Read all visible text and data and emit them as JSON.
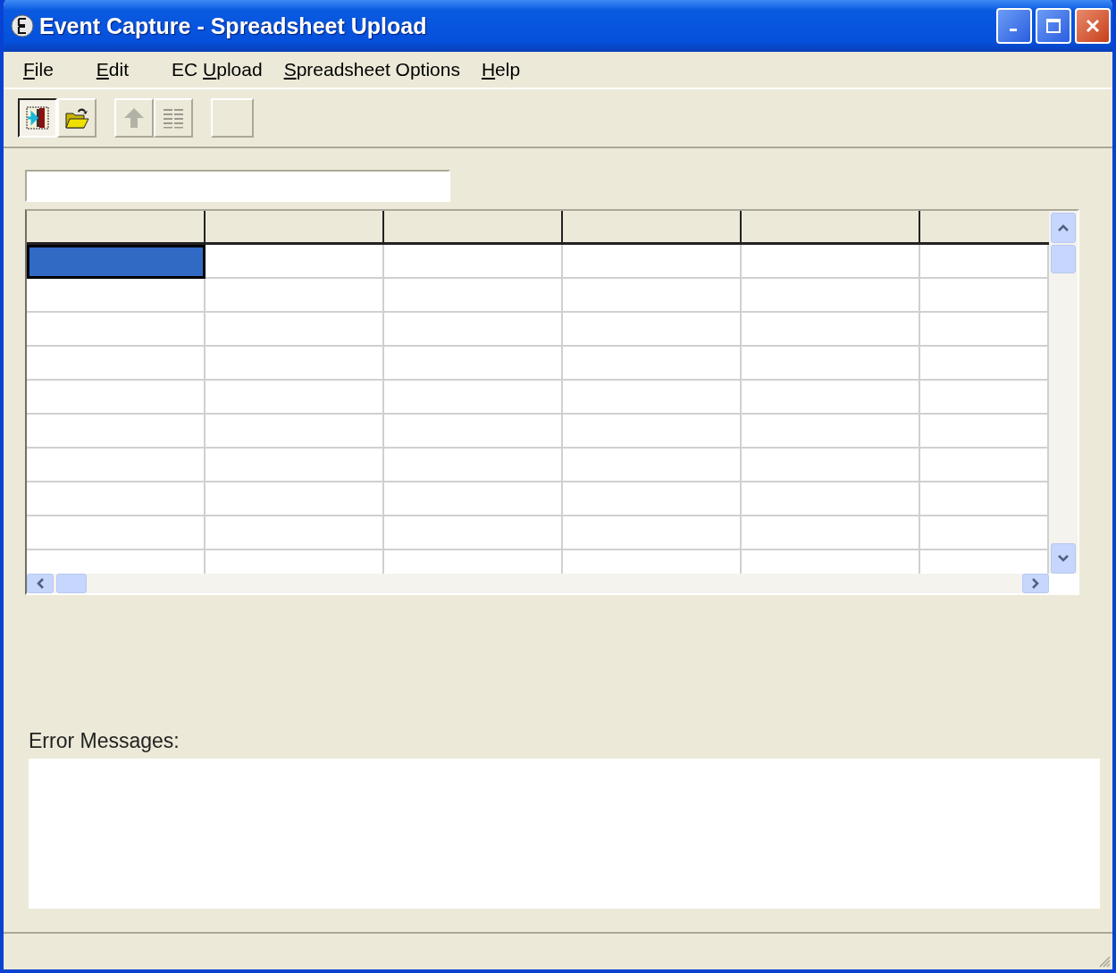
{
  "window": {
    "title": "Event Capture - Spreadsheet Upload"
  },
  "menu": [
    {
      "parts": [
        {
          "text": "F",
          "underline": true
        },
        {
          "text": "ile",
          "underline": false
        }
      ]
    },
    {
      "parts": [
        {
          "text": "E",
          "underline": true
        },
        {
          "text": "dit",
          "underline": false
        }
      ]
    },
    {
      "parts": [
        {
          "text": "EC ",
          "underline": false
        },
        {
          "text": "U",
          "underline": true
        },
        {
          "text": "pload",
          "underline": false
        }
      ]
    },
    {
      "parts": [
        {
          "text": "S",
          "underline": true
        },
        {
          "text": "preadsheet Options",
          "underline": false
        }
      ]
    },
    {
      "parts": [
        {
          "text": "H",
          "underline": true
        },
        {
          "text": "elp",
          "underline": false
        }
      ]
    }
  ],
  "toolbar": [
    {
      "kind": "exit",
      "pressed": true,
      "disabled": false
    },
    {
      "kind": "open",
      "pressed": false,
      "disabled": false
    },
    {
      "kind": "separator"
    },
    {
      "kind": "upload",
      "pressed": false,
      "disabled": true
    },
    {
      "kind": "list",
      "pressed": false,
      "disabled": true
    },
    {
      "kind": "separator"
    },
    {
      "kind": "blank",
      "pressed": false
    }
  ],
  "grid": {
    "rows": [
      {
        "cells": [
          {
            "selected": true
          },
          {
            "selected": false
          },
          {
            "selected": false
          },
          {
            "selected": false
          },
          {
            "selected": false
          },
          {
            "selected": false
          }
        ]
      },
      {
        "cells": [
          {
            "selected": false
          },
          {
            "selected": false
          },
          {
            "selected": false
          },
          {
            "selected": false
          },
          {
            "selected": false
          },
          {
            "selected": false
          }
        ]
      },
      {
        "cells": [
          {
            "selected": false
          },
          {
            "selected": false
          },
          {
            "selected": false
          },
          {
            "selected": false
          },
          {
            "selected": false
          },
          {
            "selected": false
          }
        ]
      },
      {
        "cells": [
          {
            "selected": false
          },
          {
            "selected": false
          },
          {
            "selected": false
          },
          {
            "selected": false
          },
          {
            "selected": false
          },
          {
            "selected": false
          }
        ]
      },
      {
        "cells": [
          {
            "selected": false
          },
          {
            "selected": false
          },
          {
            "selected": false
          },
          {
            "selected": false
          },
          {
            "selected": false
          },
          {
            "selected": false
          }
        ]
      },
      {
        "cells": [
          {
            "selected": false
          },
          {
            "selected": false
          },
          {
            "selected": false
          },
          {
            "selected": false
          },
          {
            "selected": false
          },
          {
            "selected": false
          }
        ]
      },
      {
        "cells": [
          {
            "selected": false
          },
          {
            "selected": false
          },
          {
            "selected": false
          },
          {
            "selected": false
          },
          {
            "selected": false
          },
          {
            "selected": false
          }
        ]
      },
      {
        "cells": [
          {
            "selected": false
          },
          {
            "selected": false
          },
          {
            "selected": false
          },
          {
            "selected": false
          },
          {
            "selected": false
          },
          {
            "selected": false
          }
        ]
      },
      {
        "cells": [
          {
            "selected": false
          },
          {
            "selected": false
          },
          {
            "selected": false
          },
          {
            "selected": false
          },
          {
            "selected": false
          },
          {
            "selected": false
          }
        ]
      },
      {
        "cells": [
          {
            "selected": false
          },
          {
            "selected": false
          },
          {
            "selected": false
          },
          {
            "selected": false
          },
          {
            "selected": false
          },
          {
            "selected": false
          }
        ]
      }
    ]
  },
  "error_panel": {
    "label": "Error Messages:"
  }
}
